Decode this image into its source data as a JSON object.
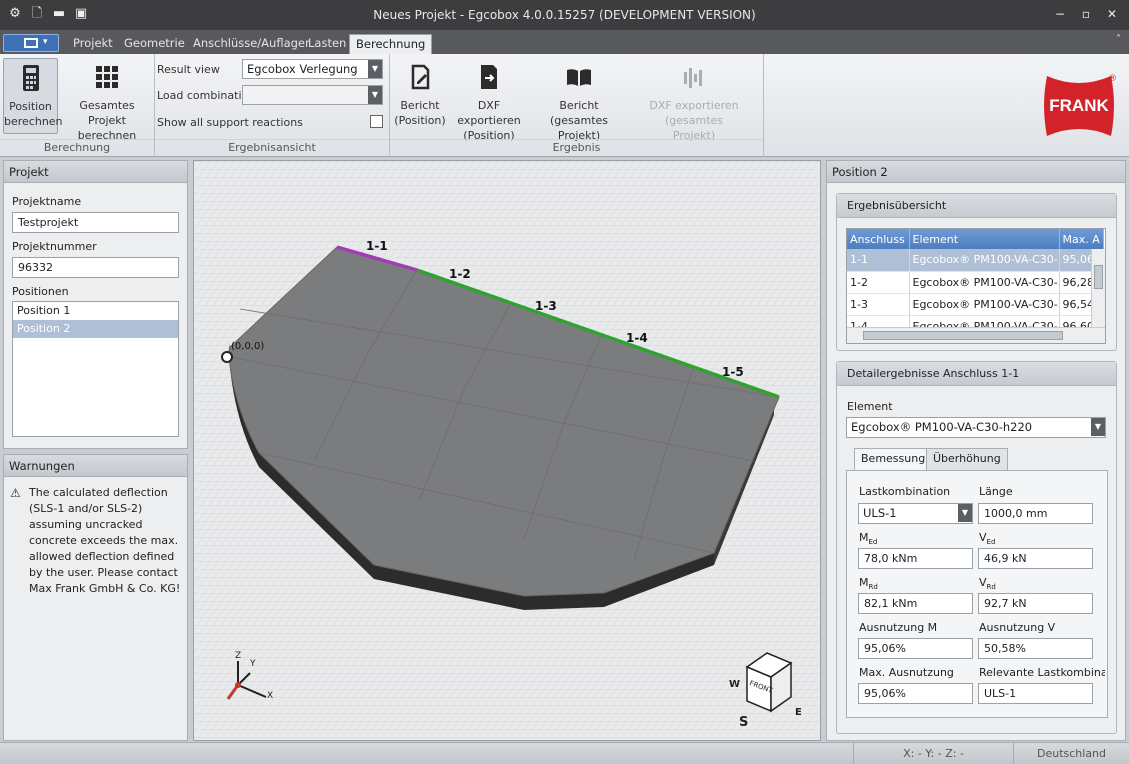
{
  "app": {
    "title": "Neues Projekt - Egcobox 4.0.0.15257 (DEVELOPMENT VERSION)"
  },
  "ribbon_tabs": [
    {
      "label": "Projekt"
    },
    {
      "label": "Geometrie"
    },
    {
      "label": "Anschlüsse/Auflager"
    },
    {
      "label": "Lasten"
    },
    {
      "label": "Berechnung",
      "active": true
    }
  ],
  "ribbon": {
    "berechnung": {
      "btn_position": {
        "line1": "Position",
        "line2": "berechnen"
      },
      "btn_gesamt": {
        "line1": "Gesamtes Projekt",
        "line2": "berechnen"
      },
      "group_label": "Berechnung"
    },
    "ergebnisansicht": {
      "result_view_label": "Result view",
      "result_view_value": "Egcobox Verlegung",
      "load_combination_label": "Load combination",
      "load_combination_value": "",
      "support_reactions_label": "Show all support reactions",
      "support_reactions_checked": false,
      "group_label": "Ergebnisansicht"
    },
    "ergebnis": {
      "bericht_position": {
        "line1": "Bericht",
        "line2": "(Position)"
      },
      "dxf_position": {
        "line1": "DXF exportieren",
        "line2": "(Position)"
      },
      "bericht_gesamt": {
        "line1": "Bericht (gesamtes",
        "line2": "Projekt)"
      },
      "dxf_gesamt": {
        "line1": "DXF exportieren (gesamtes",
        "line2": "Projekt)",
        "disabled": true
      },
      "group_label": "Ergebnis"
    },
    "logo_text": "FRANK",
    "logo_mark": "®"
  },
  "projekt_panel": {
    "title": "Projekt",
    "projektname_label": "Projektname",
    "projektname_value": "Testprojekt",
    "projektnummer_label": "Projektnummer",
    "projektnummer_value": "96332",
    "positionen_label": "Positionen",
    "positionen": [
      {
        "label": "Position 1",
        "selected": false
      },
      {
        "label": "Position 2",
        "selected": true
      }
    ]
  },
  "warnungen_panel": {
    "title": "Warnungen",
    "message": "The calculated deflection (SLS-1 and/or SLS-2) assuming uncracked concrete exceeds the max. allowed deflection defined by the user. Please contact Max Frank GmbH & Co. KG!"
  },
  "viewport": {
    "origin_label": "(0,0,0)",
    "connections": [
      {
        "label": "1-1",
        "color": "#a23bb5"
      },
      {
        "label": "1-2",
        "color": "#2fa32f"
      },
      {
        "label": "1-3",
        "color": "#2fa32f"
      },
      {
        "label": "1-4",
        "color": "#2fa32f"
      },
      {
        "label": "1-5",
        "color": "#2fa32f"
      }
    ],
    "axes": {
      "z": "Z",
      "y": "Y",
      "x": "X"
    },
    "viewcube": {
      "front": "FRONT",
      "w": "W",
      "e": "E",
      "s": "S"
    }
  },
  "right_panel": {
    "title": "Position 2",
    "overview": {
      "title": "Ergebnisübersicht",
      "columns": [
        "Anschluss",
        "Element",
        "Max. A"
      ],
      "rows": [
        {
          "anschluss": "1-1",
          "element": "Egcobox® PM100-VA-C30-...",
          "max": "95,06",
          "selected": true
        },
        {
          "anschluss": "1-2",
          "element": "Egcobox® PM100-VA-C30-...",
          "max": "96,28"
        },
        {
          "anschluss": "1-3",
          "element": "Egcobox® PM100-VA-C30-...",
          "max": "96,54"
        },
        {
          "anschluss": "1-4",
          "element": "Egcobox® PM100-VA-C30-...",
          "max": "96,60"
        }
      ]
    },
    "detail": {
      "title": "Detailergebnisse Anschluss 1-1",
      "element_label": "Element",
      "element_value": "Egcobox® PM100-VA-C30-h220",
      "tabs": [
        {
          "label": "Bemessung",
          "active": true
        },
        {
          "label": "Überhöhung",
          "active": false
        }
      ],
      "lastkombination_label": "Lastkombination",
      "lastkombination_value": "ULS-1",
      "laenge_label": "Länge",
      "laenge_value": "1000,0 mm",
      "med_label": "M",
      "med_sub": "Ed",
      "med_value": "78,0 kNm",
      "ved_label": "V",
      "ved_sub": "Ed",
      "ved_value": "46,9 kN",
      "mrd_label": "M",
      "mrd_sub": "Rd",
      "mrd_value": "82,1 kNm",
      "vrd_label": "V",
      "vrd_sub": "Rd",
      "vrd_value": "92,7 kN",
      "ausnutzung_m_label": "Ausnutzung M",
      "ausnutzung_m_value": "95,06%",
      "ausnutzung_v_label": "Ausnutzung V",
      "ausnutzung_v_value": "50,58%",
      "max_ausnutzung_label": "Max. Ausnutzung",
      "max_ausnutzung_value": "95,06%",
      "relevante_label": "Relevante Lastkombinatio",
      "relevante_value": "ULS-1"
    }
  },
  "status": {
    "coords": "X: -  Y: -  Z: -",
    "country": "Deutschland"
  },
  "colors": {
    "accent": "#4d7dc0",
    "brand": "#d2232a",
    "connection_purple": "#a23bb5",
    "connection_green": "#2fa32f"
  }
}
